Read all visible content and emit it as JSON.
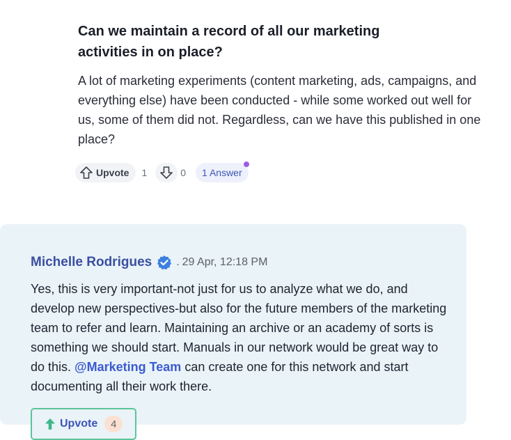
{
  "question": {
    "title": "Can we maintain a record of all our marketing activities in on place?",
    "body": "A lot of marketing experiments (content marketing, ads, campaigns, and everything else) have been conducted - while some worked out well for us, some of them did not. Regardless, can we have this published in one place?",
    "upvote_label": "Upvote",
    "upvote_count": "1",
    "downvote_count": "0",
    "answers_label": "1 Answer"
  },
  "answer": {
    "author": "Michelle Rodrigues",
    "separator": ".",
    "date": "29 Apr, 12:18 PM",
    "body_before_mention": "Yes, this is very important-not just for us to analyze what we do, and develop new perspectives-but also for the future members of the marketing team to refer and learn. Maintaining an archive or an academy of sorts is something we should start. Manuals in our network would be great way to do this. ",
    "mention": "@Marketing Team",
    "body_after_mention": " can create one for this network and start documenting all their work there.",
    "upvote_label": "Upvote",
    "upvote_count": "4"
  },
  "colors": {
    "accent": "#3b4fa1",
    "card_bg": "#eaf3f8",
    "upvote_border": "#5cc49a",
    "notification_dot": "#9b5de5",
    "verified": "#3d7fe0"
  },
  "icons": [
    "arrow-up-outline-icon",
    "arrow-down-outline-icon",
    "verified-badge-icon",
    "arrow-up-filled-icon"
  ]
}
